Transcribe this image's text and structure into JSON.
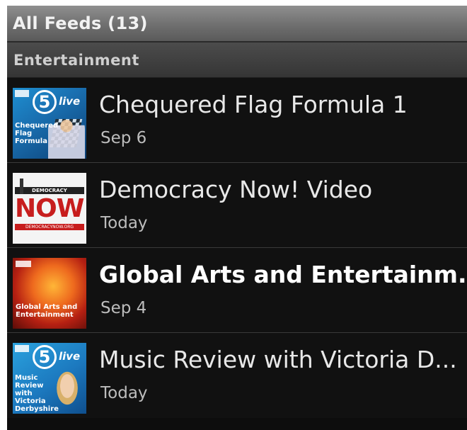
{
  "header": {
    "title": "All Feeds (13)"
  },
  "section": {
    "label": "Entertainment"
  },
  "feeds": [
    {
      "title": "Chequered Flag Formula 1",
      "date": "Sep 6",
      "unread": false,
      "thumb": {
        "badge": "5",
        "tag": "live",
        "caption": "Chequered Flag Formula"
      }
    },
    {
      "title": "Democracy Now! Video",
      "date": "Today",
      "unread": false,
      "thumb": {
        "strip": "DEMOCRACY",
        "logo": "NOW!",
        "url": "DEMOCRACYNOW.ORG"
      }
    },
    {
      "title": "Global Arts and Entertainm...",
      "date": "Sep 4",
      "unread": true,
      "thumb": {
        "caption": "Global Arts and Entertainment"
      }
    },
    {
      "title": "Music Review with Victoria D...",
      "date": "Today",
      "unread": false,
      "thumb": {
        "badge": "5",
        "tag": "live",
        "caption": "Music Review with Victoria Derbyshire"
      }
    }
  ],
  "colors": {
    "background": "#0d0d0d",
    "title_bar": "#7a7a7a",
    "section_header": "#3f3f3f",
    "text_primary": "#e8e8e8",
    "text_secondary": "#bdbdbd"
  }
}
